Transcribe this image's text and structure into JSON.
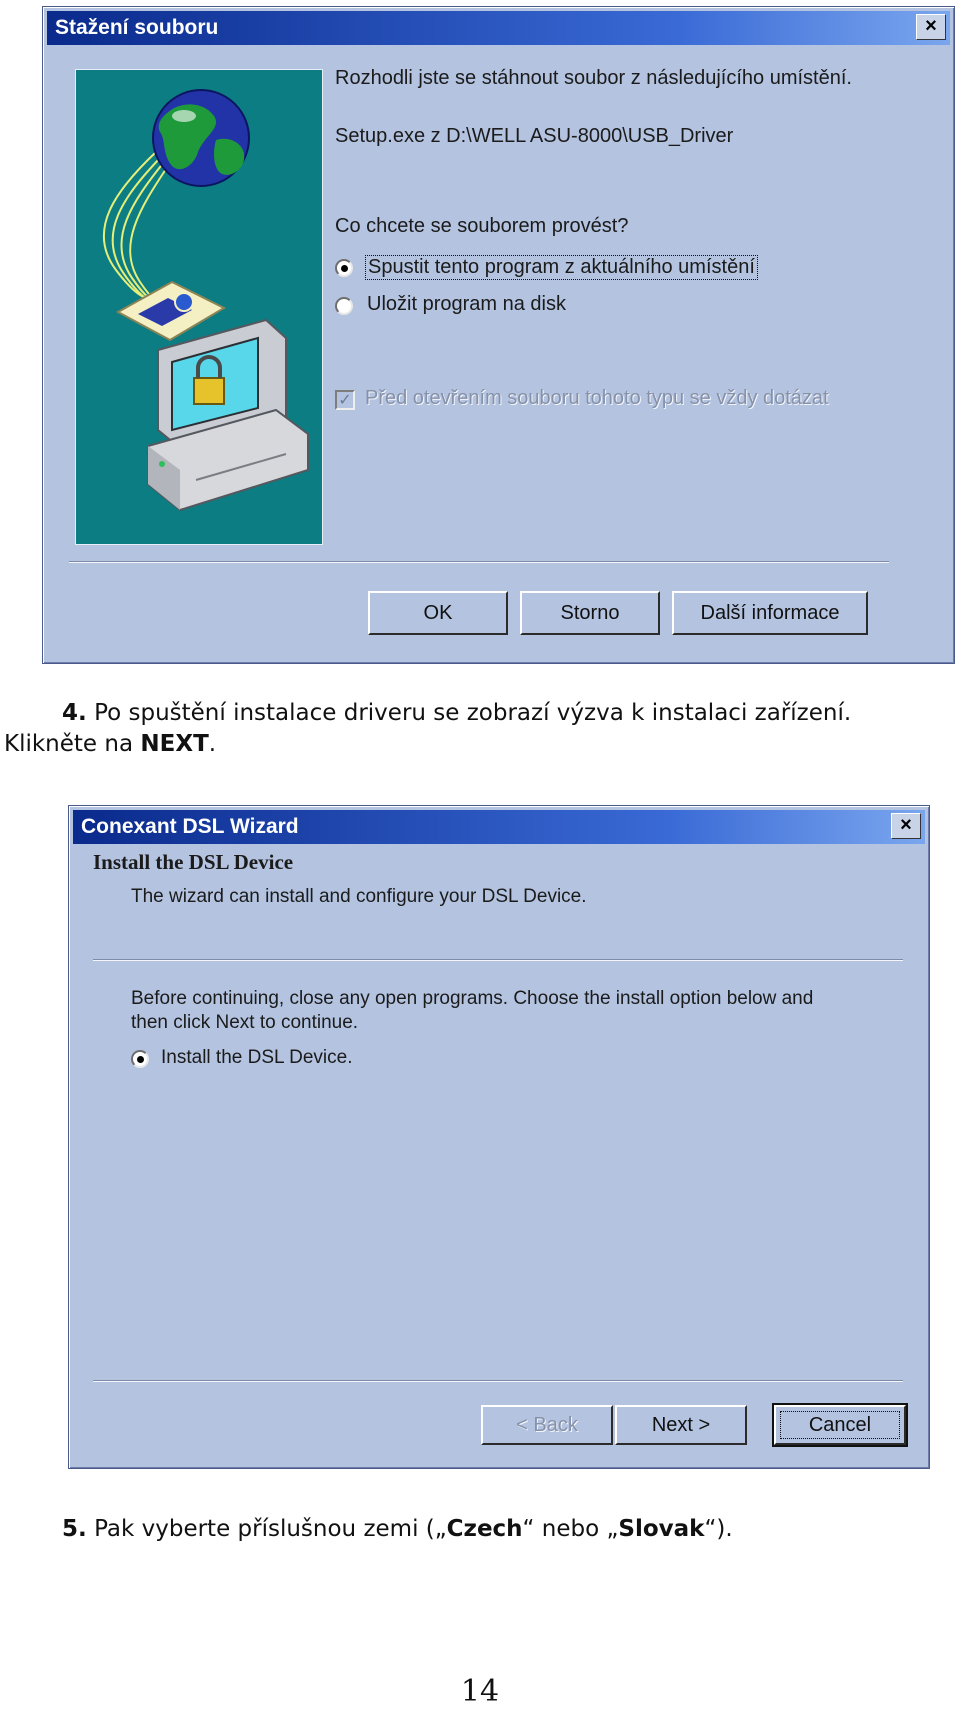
{
  "download_dialog": {
    "title": "Stažení souboru",
    "close_glyph": "×",
    "intro": "Rozhodli jste se stáhnout soubor z následujícího umístění.",
    "file_location": "Setup.exe z D:\\WELL ASU-8000\\USB_Driver",
    "question": "Co chcete se souborem provést?",
    "options": [
      {
        "label": "Spustit tento program z aktuálního umístění",
        "selected": true
      },
      {
        "label": "Uložit program na disk",
        "selected": false
      }
    ],
    "always_ask": {
      "label": "Před otevřením souboru tohoto typu se vždy dotázat",
      "checked": true,
      "disabled": true
    },
    "buttons": {
      "ok": "OK",
      "cancel": "Storno",
      "more_info": "Další informace"
    },
    "illustration_icons": [
      "globe-icon",
      "certificate-icon",
      "computer-lock-icon"
    ]
  },
  "instruction_4": {
    "number": "4.",
    "text_line1": "Po spuštění instalace driveru se zobrazí výzva k instalaci zařízení.",
    "text_line2_prefix": "Klikněte na ",
    "text_line2_bold": "NEXT",
    "text_line2_suffix": "."
  },
  "wizard_dialog": {
    "title": "Conexant DSL Wizard",
    "close_glyph": "×",
    "heading": "Install the DSL Device",
    "subheading": "The wizard can install and configure your DSL Device.",
    "instructions_line1": "Before continuing, close any open programs.  Choose the install option below and",
    "instructions_line2": "then click Next to continue.",
    "option": {
      "label": "Install the DSL Device.",
      "selected": true
    },
    "buttons": {
      "back": "< Back",
      "next": "Next >",
      "cancel": "Cancel"
    }
  },
  "instruction_5": {
    "number": "5.",
    "prefix": "Pak vyberte příslušnou zemi (",
    "q1": "„",
    "bold1": "Czech",
    "q2": "“ nebo „",
    "bold2": "Slovak",
    "suffix": "“)."
  },
  "page_number": "14",
  "colors": {
    "dialog_bg": "#b3c3e0",
    "title_gradient_start": "#0a2a8c",
    "illustration_bg": "#0b7d83"
  }
}
